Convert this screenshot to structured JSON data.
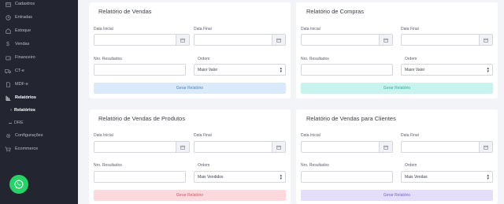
{
  "sidebar": {
    "items": [
      {
        "label": "Cadastros",
        "icon": "box-icon"
      },
      {
        "label": "Entradas",
        "icon": "clock-icon"
      },
      {
        "label": "Estoque",
        "icon": "warehouse-icon"
      },
      {
        "label": "Vendas",
        "icon": "dollar-icon"
      },
      {
        "label": "Financeiro",
        "icon": "wallet-icon"
      },
      {
        "label": "CT-e",
        "icon": "truck-icon"
      },
      {
        "label": "MDF-e",
        "icon": "document-icon"
      },
      {
        "label": "Relatórios",
        "icon": "chart-icon"
      },
      {
        "label": "Relatórios",
        "icon": "chevron-down-icon"
      },
      {
        "label": "DRE",
        "icon": "dash-icon"
      },
      {
        "label": "Configurações",
        "icon": "gear-icon"
      },
      {
        "label": "Ecommerce",
        "icon": "cart-icon"
      }
    ]
  },
  "cards": {
    "vendas": {
      "title": "Relatório de Vendas",
      "data_inicial": "Data Inicial",
      "data_final": "Data Final",
      "nro_resultados": "Nro. Resultados",
      "ordem": "Ordem",
      "ordem_value": "Maior Valor",
      "button": "Gerar Relatório"
    },
    "compras": {
      "title": "Relatório de Compras",
      "data_inicial": "Data Inicial",
      "data_final": "Data Final",
      "nro_resultados": "Nro. Resultados",
      "ordem": "Ordem",
      "ordem_value": "Maior Valor",
      "button": "Gerar Relatório"
    },
    "produtos": {
      "title": "Relatório de Vendas de Produtos",
      "data_inicial": "Data Inicial",
      "data_final": "Data Final",
      "nro_resultados": "Nro. Resultados",
      "ordem": "Ordem",
      "ordem_value": "Mais Vendidos",
      "button": "Gerar Relatório"
    },
    "clientes": {
      "title": "Relatório de Vendas para Clientes",
      "data_inicial": "Data Inicial",
      "data_final": "Data Final",
      "nro_resultados": "Nro. Resultados",
      "ordem": "Ordem",
      "ordem_value": "Mais Vendas",
      "button": "Gerar Relatório"
    }
  },
  "colors": {
    "sidebar_bg": "#232531",
    "btn_vendas_bg": "#dbeafa",
    "btn_vendas_fg": "#4a7fc4",
    "btn_compras_bg": "#c9f3ee",
    "btn_compras_fg": "#3aa89a",
    "btn_produtos_bg": "#fbd9dd",
    "btn_produtos_fg": "#d0576a",
    "btn_clientes_bg": "#e4defb",
    "btn_clientes_fg": "#7a62c9",
    "whatsapp": "#25d366"
  }
}
